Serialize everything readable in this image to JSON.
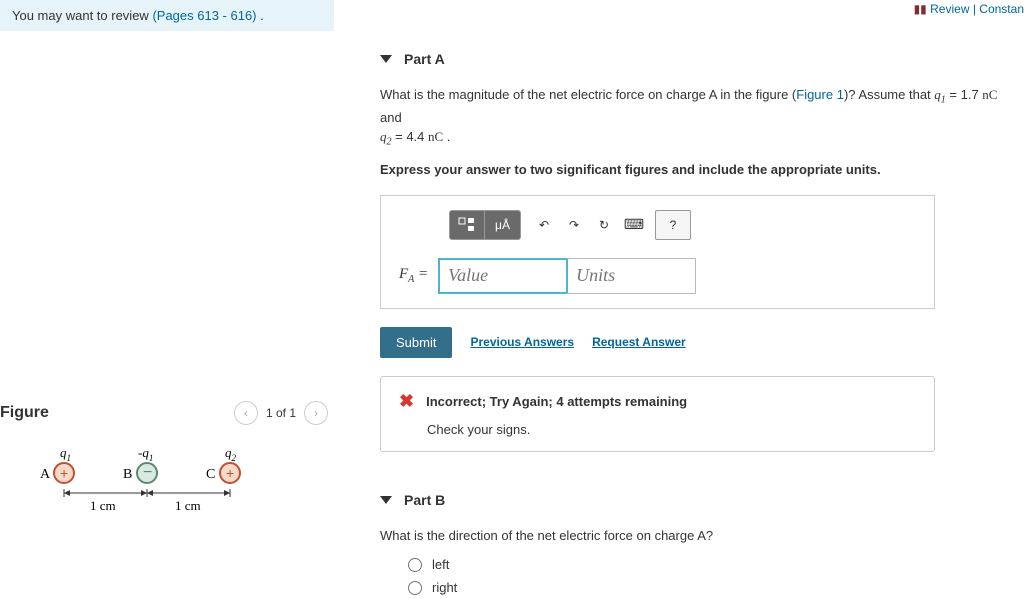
{
  "top": {
    "review": "Review",
    "sep": " | ",
    "constants": "Constan"
  },
  "hint": {
    "prefix": "You may want to review ",
    "link": "(Pages 613 - 616)",
    "suffix": " ."
  },
  "partA": {
    "title": "Part A",
    "q_prefix": "What is the magnitude of the net electric force on charge A in the figure (",
    "figlink": "Figure 1",
    "q_mid": ")? Assume that ",
    "q1_eq": " = 1.7 ",
    "q_and": " and ",
    "q2_eq": " = 4.4 ",
    "q_period": " .",
    "nC": "nC",
    "instruction": "Express your answer to two significant figures and include the appropriate units.",
    "fa_label": "F",
    "fa_sub": "A",
    "equals": " = ",
    "value_ph": "Value",
    "units_ph": "Units",
    "toolbar": {
      "muA": "μÅ",
      "help": "?"
    },
    "submit": "Submit",
    "prev_answers": "Previous Answers",
    "request": "Request Answer",
    "feedback_title": "Incorrect; Try Again; 4 attempts remaining",
    "feedback_sub": "Check your signs."
  },
  "figure": {
    "title": "Figure",
    "nav": "1 of 1",
    "labels": {
      "q1": "q",
      "q1s": "1",
      "nq1": "-q",
      "nq1s": "1",
      "q2": "q",
      "q2s": "2",
      "A": "A",
      "B": "B",
      "C": "C",
      "cm": "1 cm"
    }
  },
  "partB": {
    "title": "Part B",
    "question": "What is the direction of the net electric force on charge A?",
    "opt1": "left",
    "opt2": "right"
  }
}
